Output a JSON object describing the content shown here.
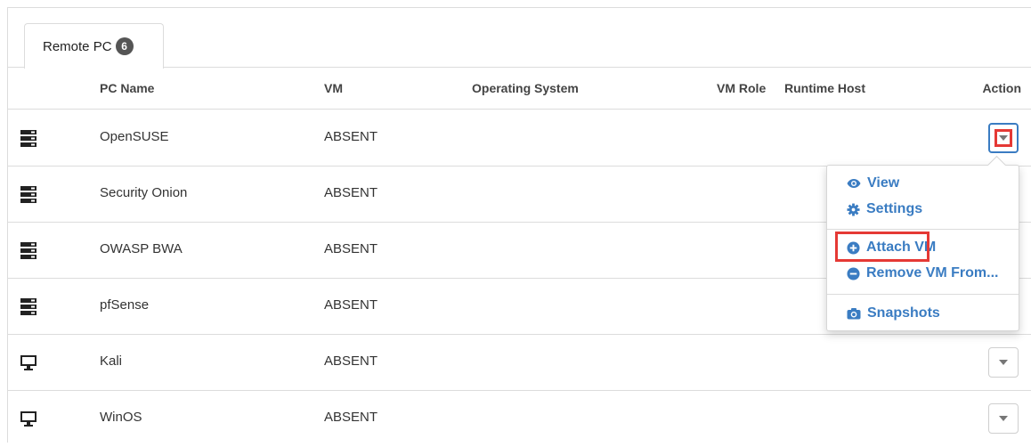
{
  "tab": {
    "label": "Remote PC",
    "count": "6"
  },
  "columns": {
    "icon": "",
    "pc_name": "PC Name",
    "vm": "VM",
    "os": "Operating System",
    "vm_role": "VM Role",
    "runtime_host": "Runtime Host",
    "action": "Action"
  },
  "rows": [
    {
      "icon": "server-icon",
      "pc_name": "OpenSUSE",
      "vm": "ABSENT",
      "os": "",
      "vm_role": "",
      "runtime_host": ""
    },
    {
      "icon": "server-icon",
      "pc_name": "Security Onion",
      "vm": "ABSENT",
      "os": "",
      "vm_role": "",
      "runtime_host": ""
    },
    {
      "icon": "server-icon",
      "pc_name": "OWASP BWA",
      "vm": "ABSENT",
      "os": "",
      "vm_role": "",
      "runtime_host": ""
    },
    {
      "icon": "server-icon",
      "pc_name": "pfSense",
      "vm": "ABSENT",
      "os": "",
      "vm_role": "",
      "runtime_host": ""
    },
    {
      "icon": "monitor-icon",
      "pc_name": "Kali",
      "vm": "ABSENT",
      "os": "",
      "vm_role": "",
      "runtime_host": ""
    },
    {
      "icon": "monitor-icon",
      "pc_name": "WinOS",
      "vm": "ABSENT",
      "os": "",
      "vm_role": "",
      "runtime_host": ""
    }
  ],
  "menu": {
    "view": "View",
    "settings": "Settings",
    "attach_vm": "Attach VM",
    "remove_vm": "Remove VM From...",
    "snapshots": "Snapshots"
  },
  "colors": {
    "link": "#3a7cc2",
    "highlight": "#e53935",
    "badge": "#555555"
  }
}
